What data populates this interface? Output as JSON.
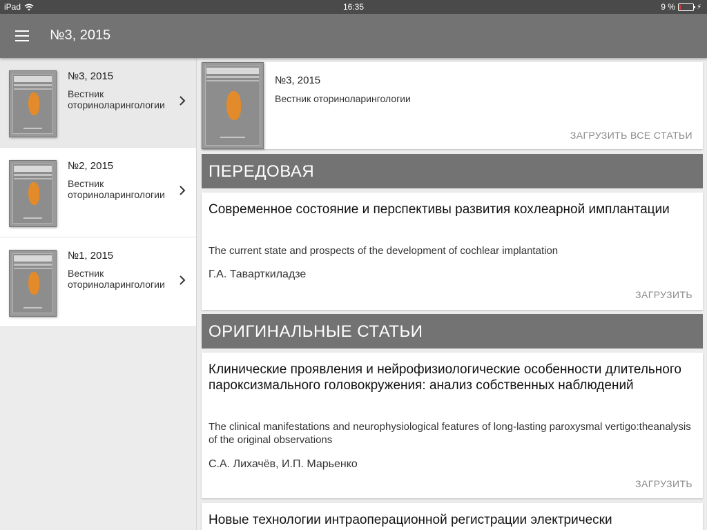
{
  "status_bar": {
    "device": "iPad",
    "time": "16:35",
    "battery": "9 %",
    "battery_level": 0.09,
    "battery_color": "#e53935"
  },
  "app_bar": {
    "title": "№3, 2015",
    "menu_icon": "menu-icon",
    "color": "#737373"
  },
  "sidebar": {
    "issues": [
      {
        "number": "№3, 2015",
        "journal": "Вестник оториноларингологии",
        "selected": true
      },
      {
        "number": "№2, 2015",
        "journal": "Вестник оториноларингологии",
        "selected": false
      },
      {
        "number": "№1, 2015",
        "journal": "Вестник оториноларингологии",
        "selected": false
      }
    ],
    "chevron_icon": "chevron-right-icon"
  },
  "issue_header": {
    "number": "№3, 2015",
    "journal": "Вестник оториноларингологии",
    "download_all": "ЗАГРУЗИТЬ ВСЕ СТАТЬИ"
  },
  "sections": [
    {
      "title": "ПЕРЕДОВАЯ",
      "articles": [
        {
          "title": "Современное состояние и перспективы развития кохлеарной имплантации",
          "title_en": "The current state and prospects of the development of cochlear implantation",
          "authors": "Г.А. Таварткиладзе",
          "download": "ЗАГРУЗИТЬ"
        }
      ]
    },
    {
      "title": "ОРИГИНАЛЬНЫЕ СТАТЬИ",
      "articles": [
        {
          "title": "Клинические проявления и нейрофизиологические особенности длительного пароксизмального головокружения: анализ собственных наблюдений",
          "title_en": "The clinical manifestations and neurophysiological features of long-lasting paroxysmal vertigo:theanalysis of the original observations",
          "authors": "С.А. Лихачёв, И.П. Марьенко",
          "download": "ЗАГРУЗИТЬ"
        },
        {
          "title": "Новые технологии интраоперационной регистрации электрически"
        }
      ]
    }
  ]
}
